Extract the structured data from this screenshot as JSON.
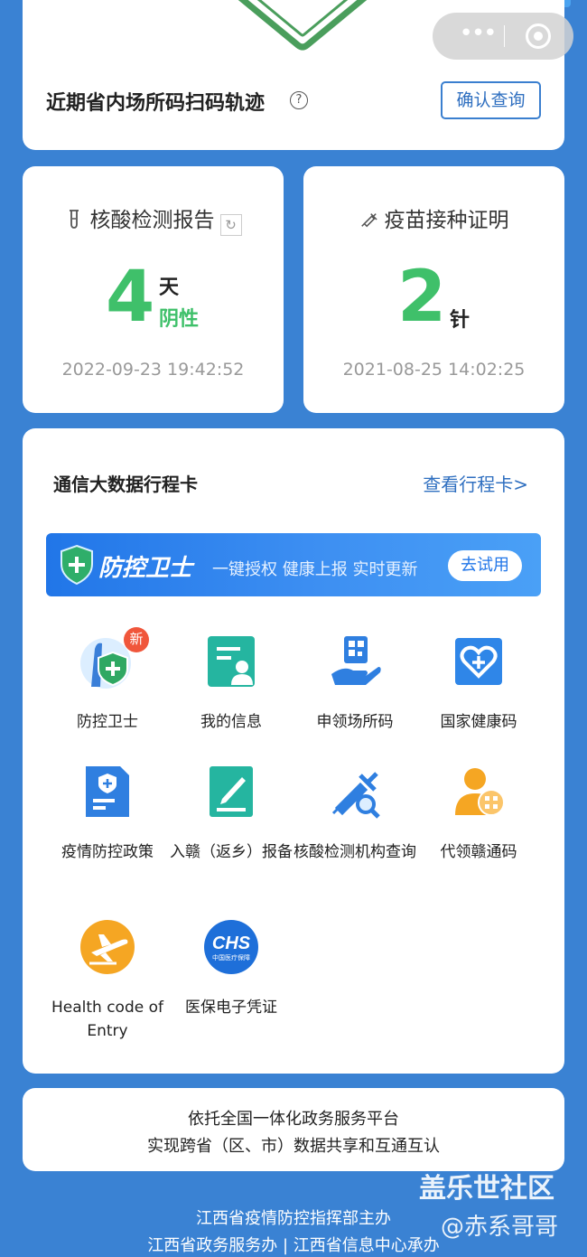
{
  "scan_card": {
    "title": "近期省内场所码扫码轨迹",
    "help_glyph": "?",
    "confirm_button": "确认查询"
  },
  "capsule": {
    "more_glyph": "•••"
  },
  "nat_card": {
    "title": "核酸检测报告",
    "refresh_glyph": "↻",
    "days_value": "4",
    "days_unit": "天",
    "result": "阴性",
    "timestamp": "2022-09-23 19:42:52"
  },
  "vaccine_card": {
    "title": "疫苗接种证明",
    "dose_value": "2",
    "dose_unit": "针",
    "timestamp": "2021-08-25 14:02:25"
  },
  "main_card": {
    "title": "通信大数据行程卡",
    "trip_link": "查看行程卡>",
    "banner": {
      "title": "防控卫士",
      "subtitle": "一键授权  健康上报  实时更新",
      "button": "去试用"
    },
    "new_badge": "新",
    "items": [
      {
        "label": "防控卫士",
        "icon": "guardian-shield-icon"
      },
      {
        "label": "我的信息",
        "icon": "my-info-icon"
      },
      {
        "label": "申领场所码",
        "icon": "place-code-icon"
      },
      {
        "label": "国家健康码",
        "icon": "national-health-code-icon"
      },
      {
        "label": "疫情防控政策",
        "icon": "policy-document-icon"
      },
      {
        "label": "入赣（返乡）报备",
        "icon": "report-edit-icon"
      },
      {
        "label": "核酸检测机构查询",
        "icon": "syringe-search-icon"
      },
      {
        "label": "代领赣通码",
        "icon": "proxy-code-icon"
      },
      {
        "label": "Health code of Entry",
        "icon": "airplane-icon"
      },
      {
        "label": "医保电子凭证",
        "icon": "chs-insurance-icon"
      }
    ],
    "chs_logo_text": "CHS",
    "chs_logo_sub": "中国医疗保障"
  },
  "footer_card": {
    "line1": "依托全国一体化政务服务平台",
    "line2": "实现跨省（区、市）数据共享和互通互认"
  },
  "bottom": {
    "line1": "江西省疫情防控指挥部主办",
    "line2": "江西省政务服务办 | 江西省信息中心承办"
  },
  "watermark": {
    "line1": "盖乐世社区",
    "line2": "@赤系哥哥"
  },
  "colors": {
    "background": "#3a82d3",
    "green": "#3fc06a",
    "link_blue": "#2f6fc0"
  }
}
